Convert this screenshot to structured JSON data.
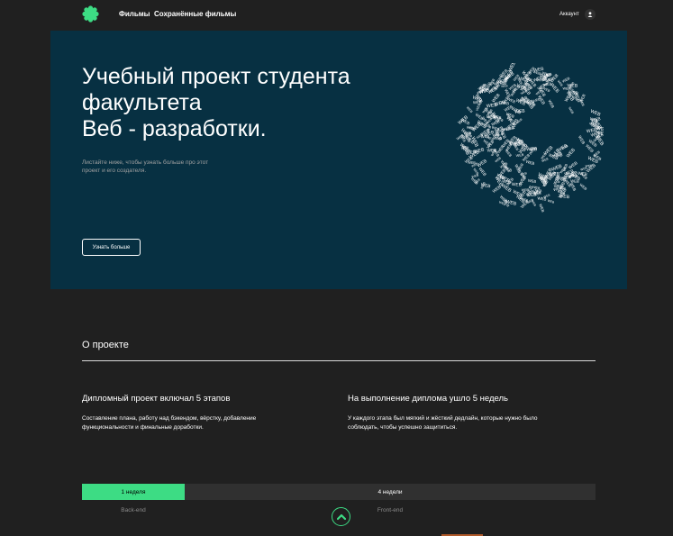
{
  "header": {
    "logo_icon": "logo-flower-icon",
    "nav": {
      "films": "Фильмы",
      "saved": "Сохранённые фильмы"
    },
    "account_label": "Аккаунт",
    "account_icon": "user-icon"
  },
  "hero": {
    "title_lines": [
      "Учебный проект студента",
      "факультета",
      "Веб - разработки."
    ],
    "subtitle": "Листайте ниже, чтобы узнать больше про этот проект и его создателя.",
    "button": "Узнать больше",
    "globe_word": "WEB",
    "background": "#073042"
  },
  "about": {
    "title": "О проекте",
    "left": {
      "heading": "Дипломный проект включал 5 этапов",
      "text": "Составление плана, работу над бэкендом, вёрстку, добавление функциональности и финальные доработки."
    },
    "right": {
      "heading": "На выполнение диплома ушло 5 недель",
      "text": "У каждого этапа был мягкий и жёсткий дедлайн, которые нужно было соблюдать, чтобы успешно защититься."
    }
  },
  "timeline": {
    "back_duration": "1 неделя",
    "front_duration": "4 недели",
    "back_label": "Back-end",
    "front_label": "Front-end"
  },
  "colors": {
    "accent": "#3ddc84",
    "bg": "#202020",
    "track": "#303030"
  },
  "scroll_up_icon": "chevron-up-icon"
}
